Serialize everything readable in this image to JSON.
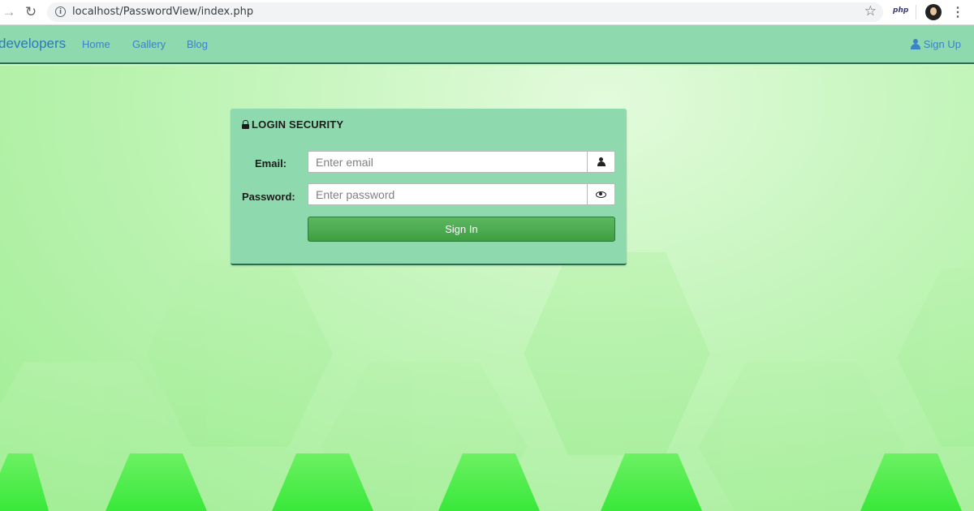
{
  "browser": {
    "url": "localhost/PasswordView/index.php",
    "extension_label": "php",
    "back_icon": "→",
    "reload_icon": "↻",
    "info_icon": "i",
    "star_icon": "☆",
    "menu_icon": "⋮"
  },
  "navbar": {
    "brand": "developers",
    "links": [
      "Home",
      "Gallery",
      "Blog"
    ],
    "signup_label": "Sign Up"
  },
  "login": {
    "title": "LOGIN SECURITY",
    "email_label": "Email:",
    "email_placeholder": "Enter email",
    "password_label": "Password:",
    "password_placeholder": "Enter password",
    "signin_label": "Sign In"
  },
  "colors": {
    "panel": "#8fd9ae",
    "navbar": "#8fd9ae",
    "link": "#3a83c6",
    "button": "#4caf50",
    "background": "#c4f5bb"
  }
}
